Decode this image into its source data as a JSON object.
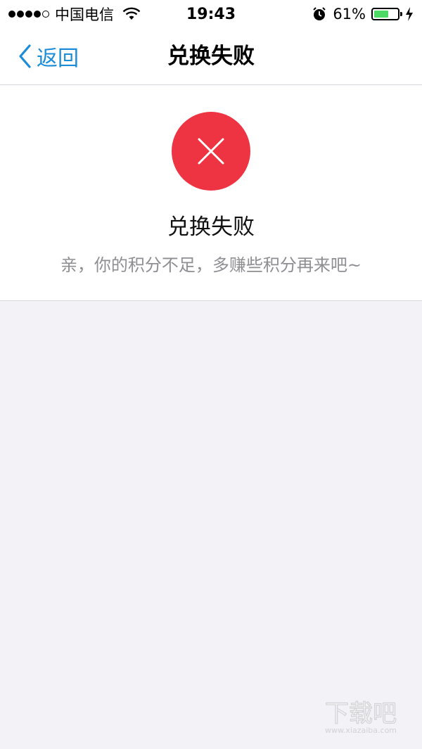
{
  "status_bar": {
    "carrier": "中国电信",
    "time": "19:43",
    "battery_percent": "61%",
    "battery_level": 0.61,
    "battery_color": "#4cd964"
  },
  "nav": {
    "back_label": "返回",
    "title": "兑换失败"
  },
  "result": {
    "icon": "close-icon",
    "icon_bg": "#ee3443",
    "title": "兑换失败",
    "message": "亲，你的积分不足，多赚些积分再来吧~"
  },
  "watermark": {
    "text": "下载吧",
    "subtext": "www.xiazaiba.com"
  }
}
